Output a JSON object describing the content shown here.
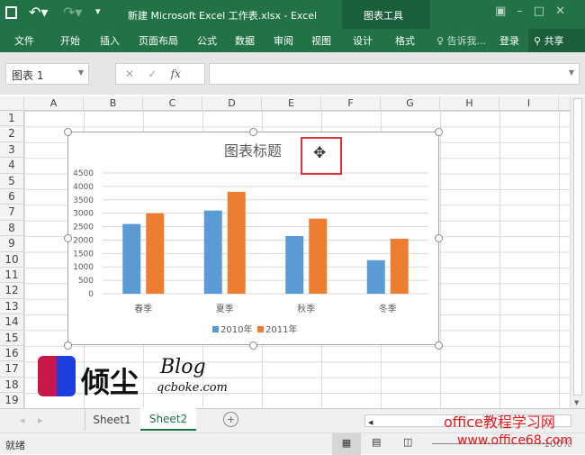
{
  "titlebar": {
    "title": "新建 Microsoft Excel 工作表.xlsx - Excel",
    "context_group": "图表工具"
  },
  "ribbon": {
    "tabs": [
      "文件",
      "开始",
      "插入",
      "页面布局",
      "公式",
      "数据",
      "审阅",
      "视图",
      "设计",
      "格式"
    ],
    "tell_me": "告诉我...",
    "login": "登录",
    "share": "共享"
  },
  "formula_bar": {
    "name_box": "图表 1",
    "fx": "fx",
    "formula": ""
  },
  "columns": [
    "A",
    "B",
    "C",
    "D",
    "E",
    "F",
    "G",
    "H",
    "I"
  ],
  "rows": [
    "1",
    "2",
    "3",
    "4",
    "5",
    "6",
    "7",
    "8",
    "9",
    "10",
    "11",
    "12",
    "13",
    "14",
    "15",
    "16",
    "17",
    "18",
    "19"
  ],
  "chart_data": {
    "type": "bar",
    "title": "图表标题",
    "categories": [
      "春季",
      "夏季",
      "秋季",
      "冬季"
    ],
    "series": [
      {
        "name": "2010年",
        "color": "#5b9bd5",
        "values": [
          2600,
          3100,
          2150,
          1250
        ]
      },
      {
        "name": "2011年",
        "color": "#ed7d31",
        "values": [
          3000,
          3800,
          2800,
          2050
        ]
      }
    ],
    "ylim": [
      0,
      4500
    ],
    "yticks": [
      0,
      500,
      1000,
      1500,
      2000,
      2500,
      3000,
      3500,
      4000,
      4500
    ],
    "legend": "bottom",
    "grid": true
  },
  "sheets": [
    {
      "name": "Sheet1"
    },
    {
      "name": "Sheet2",
      "active": true
    }
  ],
  "status": {
    "ready": "就绪",
    "zoom": "100%"
  },
  "watermarks": {
    "blog_name": "倾尘",
    "blog": "Blog",
    "blog_url": "qcboke.com",
    "site": "office教程学习网",
    "site_url": "www.office68.com"
  }
}
